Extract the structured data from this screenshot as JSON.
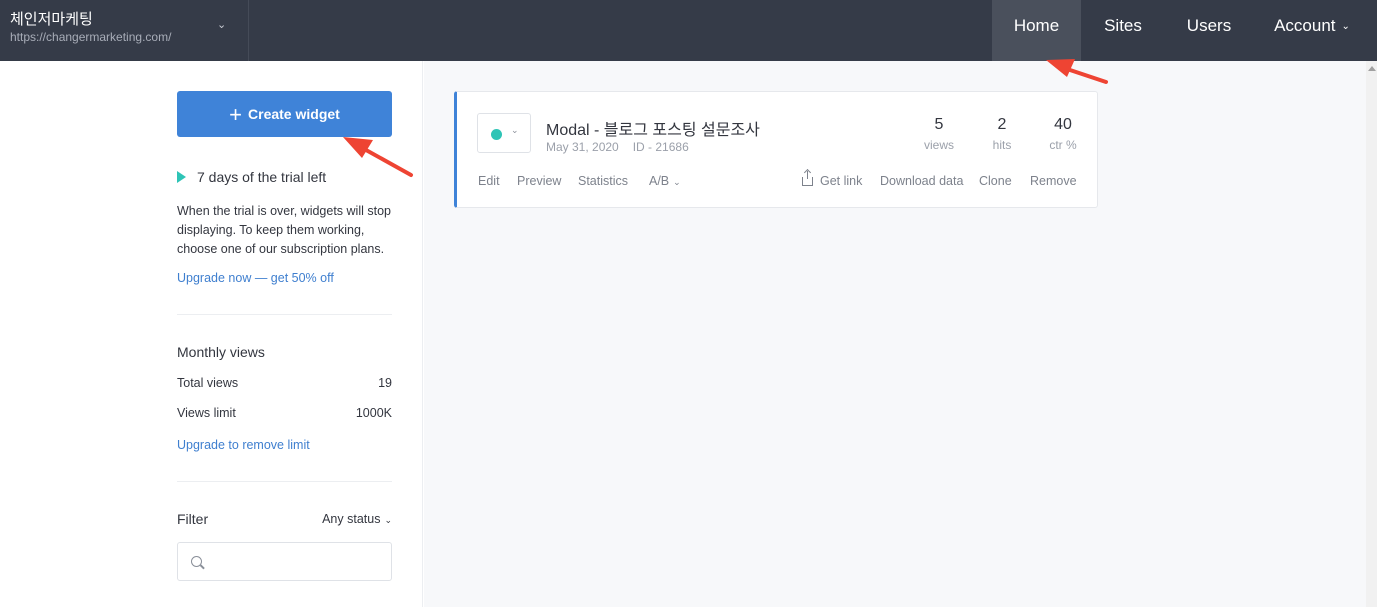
{
  "topbar": {
    "site_name": "체인저마케팅",
    "site_url": "https://changermarketing.com/",
    "nav": {
      "home": "Home",
      "sites": "Sites",
      "users": "Users",
      "account": "Account"
    },
    "active_nav": "Home"
  },
  "sidebar": {
    "create_label": "Create widget",
    "trial_days": "7 days of the trial left",
    "trial_note": "When the trial is over, widgets will stop displaying. To keep them working, choose one of our subscription plans.",
    "upgrade_link": "Upgrade now — get 50% off",
    "monthly_title": "Monthly views",
    "total_views_label": "Total views",
    "total_views_value": "19",
    "views_limit_label": "Views limit",
    "views_limit_value": "1000K",
    "remove_limit_link": "Upgrade to remove limit",
    "filter_label": "Filter",
    "filter_status": "Any status",
    "filter_search_value": ""
  },
  "widget": {
    "title": "Modal - 블로그 포스팅 설문조사",
    "date": "May 31, 2020",
    "id": "ID - 21686",
    "status_color": "#2ec4b6",
    "views_value": "5",
    "views_label": "views",
    "hits_value": "2",
    "hits_label": "hits",
    "ctr_value": "40",
    "ctr_label": "ctr %",
    "actions": {
      "edit": "Edit",
      "preview": "Preview",
      "statistics": "Statistics",
      "ab": "A/B",
      "get_link": "Get link",
      "download": "Download data",
      "clone": "Clone",
      "remove": "Remove"
    }
  },
  "colors": {
    "topbar": "#353b48",
    "accent": "#3f83d8",
    "status": "#2ec4b6",
    "annotation_arrow": "#ee4433"
  },
  "icons": [
    "chevron-down-icon",
    "plus-icon",
    "play-icon",
    "search-icon",
    "share-icon",
    "scroll-up-icon"
  ]
}
